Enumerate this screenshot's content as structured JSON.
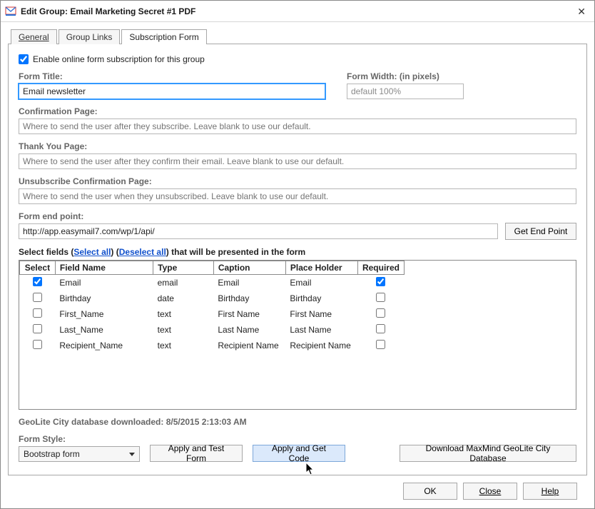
{
  "window": {
    "title": "Edit Group: Email Marketing Secret #1 PDF"
  },
  "tabs": {
    "general": "General",
    "group_links": "Group Links",
    "subscription_form": "Subscription Form"
  },
  "enable_checkbox_label": "Enable online form subscription for this group",
  "form_title": {
    "label": "Form Title:",
    "value": "Email newsletter"
  },
  "form_width": {
    "label": "Form Width: (in pixels)",
    "value": "default 100%"
  },
  "confirmation_page": {
    "label": "Confirmation Page:",
    "placeholder": "Where to send the user after they subscribe. Leave blank to use our default."
  },
  "thank_you_page": {
    "label": "Thank You Page:",
    "placeholder": "Where to send the user after they confirm their email. Leave blank to use our default."
  },
  "unsubscribe_page": {
    "label": "Unsubscribe Confirmation Page:",
    "placeholder": "Where to send the user when they unsubscribed. Leave blank to use our default."
  },
  "endpoint": {
    "label": "Form end point:",
    "value": "http://app.easymail7.com/wp/1/api/",
    "button": "Get End Point"
  },
  "fields_header": {
    "prefix": "Select fields (",
    "select_all": "Select all",
    "mid": ") (",
    "deselect_all": "Deselect all",
    "suffix": ")  that will be presented in the form"
  },
  "columns": {
    "select": "Select",
    "field_name": "Field Name",
    "type": "Type",
    "caption": "Caption",
    "placeholder": "Place Holder",
    "required": "Required"
  },
  "rows": [
    {
      "selected": true,
      "field": "Email",
      "type": "email",
      "caption": "Email",
      "placeholder": "Email",
      "required": true
    },
    {
      "selected": false,
      "field": "Birthday",
      "type": "date",
      "caption": "Birthday",
      "placeholder": "Birthday",
      "required": false
    },
    {
      "selected": false,
      "field": "First_Name",
      "type": "text",
      "caption": "First Name",
      "placeholder": "First Name",
      "required": false
    },
    {
      "selected": false,
      "field": "Last_Name",
      "type": "text",
      "caption": "Last Name",
      "placeholder": "Last Name",
      "required": false
    },
    {
      "selected": false,
      "field": "Recipient_Name",
      "type": "text",
      "caption": "Recipient Name",
      "placeholder": "Recipient Name",
      "required": false
    }
  ],
  "geolite_status": "GeoLite City database downloaded: 8/5/2015 2:13:03 AM",
  "form_style": {
    "label": "Form Style:",
    "value": "Bootstrap form"
  },
  "buttons": {
    "apply_test": "Apply and Test Form",
    "apply_code": "Apply and Get Code",
    "download_db": "Download MaxMind GeoLite City Database",
    "ok": "OK",
    "close": "Close",
    "help": "Help"
  }
}
